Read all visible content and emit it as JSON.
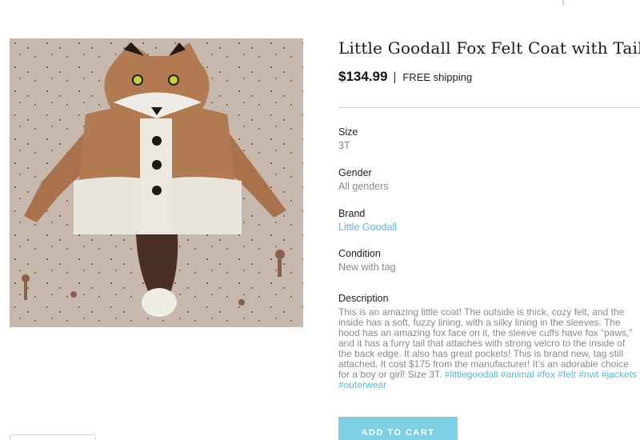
{
  "product": {
    "title": "Little Goodall Fox Felt Coat with Tail",
    "price": "$134.99",
    "separator": "|",
    "shipping": "FREE shipping"
  },
  "attributes": {
    "size": {
      "label": "Size",
      "value": "3T"
    },
    "gender": {
      "label": "Gender",
      "value": "All genders"
    },
    "brand": {
      "label": "Brand",
      "value": "Little Goodall"
    },
    "condition": {
      "label": "Condition",
      "value": "New with tag"
    }
  },
  "description": {
    "label": "Description",
    "text": "This is an amazing little coat! The outside is thick, cozy felt, and the inside has a soft, fuzzy lining, with a silky lining in the sleeves. The hood has an amazing fox face on it, the sleeve cuffs have fox “paws,” and it has a furry tail that attaches with strong velcro to the inside of the back edge. It also has great pockets! This is brand new, tag still attached. It cost $175 from the manufacturer! It’s an adorable choice for a boy or girl! Size 3T.",
    "hashtags": [
      "#littlegoodall",
      "#animal",
      "#fox",
      "#felt",
      "#nwt",
      "#jackets",
      "#outerwear"
    ]
  },
  "actions": {
    "add_to_cart": "ADD TO CART"
  },
  "colors": {
    "link": "#5cb8d6",
    "button": "#7ecfe1",
    "muted_text": "#8a8a8a"
  }
}
